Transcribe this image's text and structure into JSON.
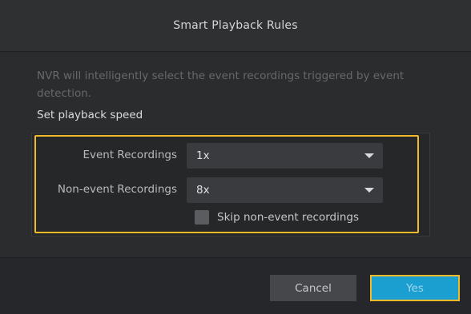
{
  "dialog": {
    "title": "Smart Playback Rules",
    "description": "NVR will intelligently select the event recordings triggered by event detection.",
    "section_label": "Set playback speed"
  },
  "event_recordings": {
    "label": "Event Recordings",
    "value": "1x"
  },
  "non_event_recordings": {
    "label": "Non-event Recordings",
    "value": "8x"
  },
  "skip_option": {
    "label": "Skip non-event recordings",
    "checked": false
  },
  "buttons": {
    "cancel": "Cancel",
    "yes": "Yes"
  },
  "colors": {
    "highlight": "#f2b92b",
    "primary": "#1b9fd0",
    "background": "#2b2c2e"
  },
  "icons": {
    "dropdown": "chevron-down-icon",
    "checkbox": "checkbox-icon"
  }
}
